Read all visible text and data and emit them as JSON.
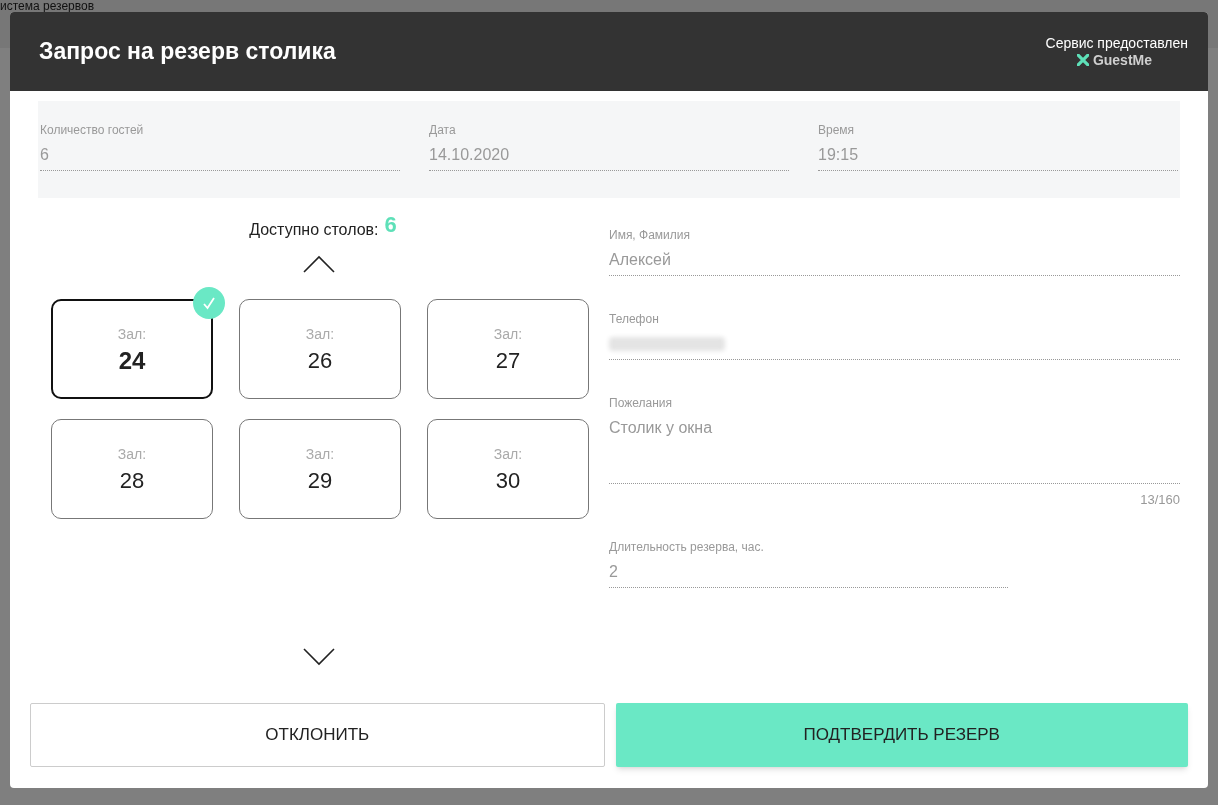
{
  "background": {
    "title": "истема резервов"
  },
  "modal": {
    "title": "Запрос на резерв столика",
    "provider_label": "Сервис предоставлен",
    "provider_name": "GuestMe"
  },
  "summary_fields": [
    {
      "label": "Количество гостей",
      "value": "6"
    },
    {
      "label": "Дата",
      "value": "14.10.2020"
    },
    {
      "label": "Время",
      "value": "19:15"
    }
  ],
  "tables": {
    "label": "Доступно столов:",
    "count": "6",
    "items": [
      {
        "hall_label": "Зал:",
        "number": "24",
        "selected": true
      },
      {
        "hall_label": "Зал:",
        "number": "26",
        "selected": false
      },
      {
        "hall_label": "Зал:",
        "number": "27",
        "selected": false
      },
      {
        "hall_label": "Зал:",
        "number": "28",
        "selected": false
      },
      {
        "hall_label": "Зал:",
        "number": "29",
        "selected": false
      },
      {
        "hall_label": "Зал:",
        "number": "30",
        "selected": false
      }
    ]
  },
  "form_fields": [
    {
      "kind": "text",
      "label": "Имя, Фамилия",
      "value": "Алексей"
    },
    {
      "kind": "redacted",
      "label": "Телефон"
    },
    {
      "kind": "textarea",
      "label": "Пожелания",
      "value": "Столик у окна",
      "counter": "13/160"
    },
    {
      "kind": "short",
      "label": "Длительность резерва, час.",
      "value": "2"
    }
  ],
  "buttons": [
    {
      "label": "ОТКЛОНИТЬ",
      "kind": "secondary"
    },
    {
      "label": "ПОДТВЕРДИТЬ РЕЗЕРВ",
      "kind": "primary"
    }
  ]
}
